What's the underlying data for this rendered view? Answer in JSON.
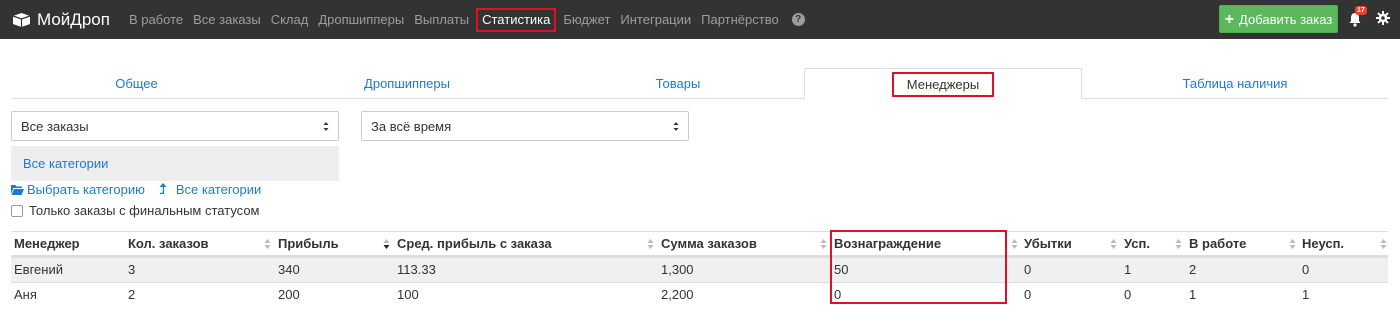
{
  "brand": {
    "name": "МойДроп"
  },
  "nav": {
    "items": [
      "В работе",
      "Все заказы",
      "Склад",
      "Дропшипперы",
      "Выплаты",
      "Статистика",
      "Бюджет",
      "Интеграции",
      "Партнёрство"
    ],
    "active": "Статистика"
  },
  "header": {
    "add_order_label": "Добавить заказ",
    "notifications_count": "17"
  },
  "tabs": [
    {
      "label": "Общее"
    },
    {
      "label": "Дропшипперы"
    },
    {
      "label": "Товары"
    },
    {
      "label": "Менеджеры"
    },
    {
      "label": "Таблица наличия"
    }
  ],
  "active_tab": "Менеджеры",
  "filters": {
    "orders_select": "Все заказы",
    "period_select": "За всё время",
    "category_current": "Все категории",
    "choose_category_link": "Выбрать категорию",
    "all_categories_link": "Все категории",
    "final_status_checkbox_label": "Только заказы с финальным статусом",
    "final_status_checked": false
  },
  "table": {
    "columns": [
      "Менеджер",
      "Кол. заказов",
      "Прибыль",
      "Сред. прибыль с заказа",
      "Сумма заказов",
      "Вознаграждение",
      "Убытки",
      "Усп.",
      "В работе",
      "Неусп."
    ],
    "sorted_column": "Сред. прибыль с заказа",
    "rows": [
      [
        "Евгений",
        "3",
        "340",
        "113.33",
        "1,300",
        "50",
        "0",
        "1",
        "2",
        "0"
      ],
      [
        "Аня",
        "2",
        "200",
        "100",
        "2,200",
        "0",
        "0",
        "0",
        "1",
        "1"
      ]
    ]
  },
  "colors": {
    "navbar": "#333333",
    "link": "#1a7bd1",
    "add_button": "#5cb85c",
    "highlight": "#e0102b"
  }
}
